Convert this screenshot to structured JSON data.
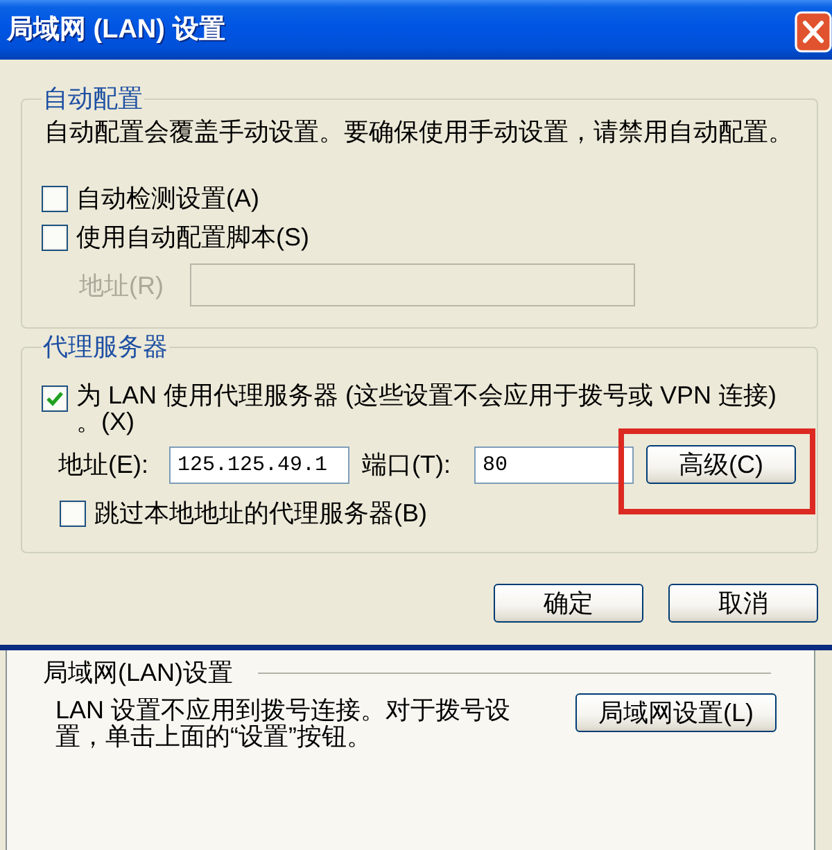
{
  "window": {
    "title": "局域网 (LAN) 设置"
  },
  "auto_config": {
    "legend": "自动配置",
    "description": "自动配置会覆盖手动设置。要确保使用手动设置，请禁用自动配置。",
    "options": [
      {
        "label": "自动检测设置(A)",
        "checked": false
      },
      {
        "label": "使用自动配置脚本(S)",
        "checked": false
      }
    ],
    "script_address": {
      "label": "地址(R)",
      "disabled": true
    }
  },
  "proxy_server": {
    "legend": "代理服务器",
    "use_proxy": {
      "label_lines": [
        "为 LAN 使用代理服务器 (这些设置不会应用于拨号或 VPN 连接)",
        "。(X)"
      ],
      "checked": true
    },
    "address": {
      "label": "地址(E):",
      "value": "125.125.49.1"
    },
    "port": {
      "label": "端口(T):",
      "value": "80"
    },
    "advanced_button": {
      "label": "高级(C)",
      "highlighted": true
    },
    "bypass_local": {
      "label": "跳过本地地址的代理服务器(B)",
      "checked": false
    }
  },
  "buttons": [
    "确定",
    "取消"
  ],
  "background_window": {
    "section_label": "局域网(LAN)设置",
    "text_lines": [
      "LAN 设置不应用到拨号连接。对于拨号设",
      "置，单击上面的“设置”按钮。"
    ],
    "button": "局域网设置(L)"
  }
}
